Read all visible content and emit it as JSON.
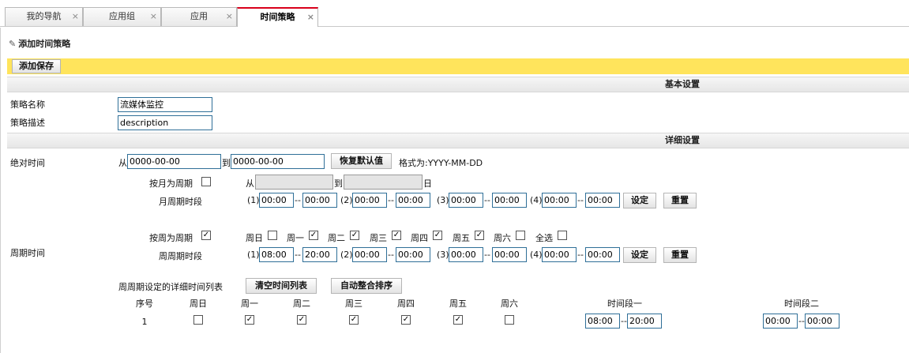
{
  "tabs": [
    {
      "label": "我的导航",
      "active": false
    },
    {
      "label": "应用组",
      "active": false
    },
    {
      "label": "应用",
      "active": false
    },
    {
      "label": "时间策略",
      "active": true
    }
  ],
  "tab_close": "×",
  "panel": {
    "title": "添加时间策略",
    "pen": "✎",
    "save_button": "添加保存"
  },
  "basic": {
    "header": "基本设置",
    "name_label": "策略名称",
    "name_value": "流媒体监控",
    "desc_label": "策略描述",
    "desc_value": "description"
  },
  "detail": {
    "header": "详细设置",
    "absolute": {
      "label": "绝对时间",
      "from": "从",
      "from_value": "0000-00-00",
      "to": "到",
      "to_value": "0000-00-00",
      "restore_button": "恢复默认值",
      "format_text": "格式为:YYYY-MM-DD"
    },
    "monthly": {
      "label": "按月为周期",
      "checked": false,
      "from": "从",
      "to": "到",
      "day": "日",
      "from_value": "",
      "to_value": "",
      "period_label": "月周期时段",
      "slots": [
        {
          "num": "(1)",
          "start": "00:00",
          "end": "00:00"
        },
        {
          "num": "(2)",
          "start": "00:00",
          "end": "00:00"
        },
        {
          "num": "(3)",
          "start": "00:00",
          "end": "00:00"
        },
        {
          "num": "(4)",
          "start": "00:00",
          "end": "00:00"
        }
      ],
      "set_button": "设定",
      "reset_button": "重置"
    },
    "cycle_label": "周期时间",
    "weekly": {
      "label": "按周为周期",
      "checked": true,
      "days": [
        {
          "label": "周日",
          "checked": false
        },
        {
          "label": "周一",
          "checked": true
        },
        {
          "label": "周二",
          "checked": true
        },
        {
          "label": "周三",
          "checked": true
        },
        {
          "label": "周四",
          "checked": true
        },
        {
          "label": "周五",
          "checked": true
        },
        {
          "label": "周六",
          "checked": false
        },
        {
          "label": "全选",
          "checked": false
        }
      ],
      "period_label": "周周期时段",
      "slots": [
        {
          "num": "(1)",
          "start": "08:00",
          "end": "20:00"
        },
        {
          "num": "(2)",
          "start": "00:00",
          "end": "00:00"
        },
        {
          "num": "(3)",
          "start": "00:00",
          "end": "00:00"
        },
        {
          "num": "(4)",
          "start": "00:00",
          "end": "00:00"
        }
      ],
      "set_button": "设定",
      "reset_button": "重置"
    },
    "list": {
      "label": "周周期设定的详细时间列表",
      "clear_button": "清空时间列表",
      "sort_button": "自动整合排序",
      "columns": [
        "序号",
        "周日",
        "周一",
        "周二",
        "周三",
        "周四",
        "周五",
        "周六",
        "时间段一",
        "时间段二"
      ],
      "rows": [
        {
          "num": "1",
          "days": [
            false,
            true,
            true,
            true,
            true,
            true,
            false
          ],
          "seg1_start": "08:00",
          "seg1_end": "20:00",
          "seg2_start": "00:00",
          "seg2_end": "00:00"
        }
      ]
    },
    "dash": "--"
  }
}
